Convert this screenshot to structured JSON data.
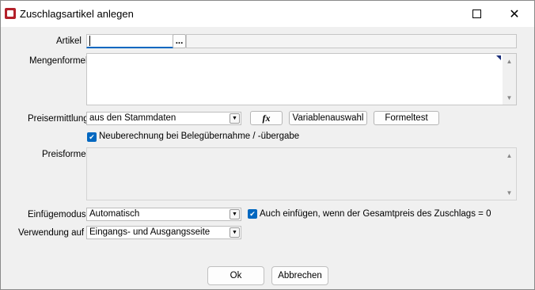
{
  "window": {
    "title": "Zuschlagsartikel anlegen",
    "min_icon": "minimize-icon",
    "max_icon": "maximize-icon",
    "close_icon": "close-icon"
  },
  "form": {
    "artikel_label": "Artikel",
    "artikel_value": "",
    "artikel_browse": "...",
    "artikel_desc": "",
    "mengenformel_label": "Mengenformel",
    "mengenformel_value": "",
    "preisermittlung_label": "Preisermittlung",
    "preisermittlung_value": "aus den Stammdaten",
    "fx_label": "fx",
    "variablenauswahl_label": "Variablenauswahl",
    "formeltest_label": "Formeltest",
    "neuberechnung_label": "Neuberechnung bei Belegübernahme / -übergabe",
    "neuberechnung_checked": true,
    "preisformel_label": "Preisformel",
    "preisformel_value": "",
    "einfuegemodus_label": "Einfügemodus",
    "einfuegemodus_value": "Automatisch",
    "auch_einfuegen_label": "Auch einfügen, wenn der Gesamtpreis des Zuschlags = 0",
    "auch_einfuegen_checked": true,
    "verwendung_label": "Verwendung auf",
    "verwendung_value": "Eingangs- und Ausgangsseite"
  },
  "footer": {
    "ok_label": "Ok",
    "cancel_label": "Abbrechen"
  },
  "colors": {
    "accent": "#0067c0",
    "app_icon": "#b3202a",
    "background": "#f0f0f0"
  }
}
